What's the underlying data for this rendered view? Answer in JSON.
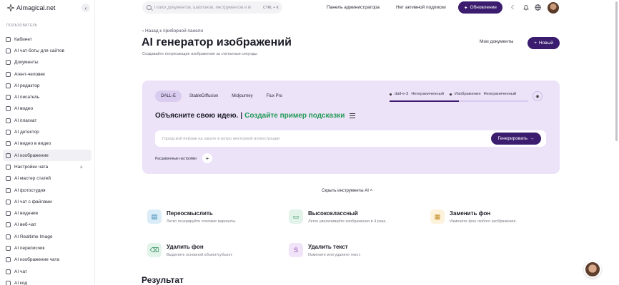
{
  "app": {
    "name": "AImagical.net"
  },
  "sidebar": {
    "section_label": "ПОЛЬЗОВАТЕЛЬ",
    "items": [
      {
        "label": "Кабинет",
        "icon": "dashboard-icon"
      },
      {
        "label": "AI чат-боты для сайтов",
        "icon": "bot-icon"
      },
      {
        "label": "Документы",
        "icon": "document-icon"
      },
      {
        "label": "Агент-человек",
        "icon": "agent-icon"
      },
      {
        "label": "AI редактор",
        "icon": "editor-icon"
      },
      {
        "label": "AI писатель",
        "icon": "writer-icon"
      },
      {
        "label": "AI видео",
        "icon": "video-icon"
      },
      {
        "label": "AI плагиат",
        "icon": "plagiarism-icon"
      },
      {
        "label": "AI детектор",
        "icon": "detector-icon"
      },
      {
        "label": "AI видео в видео",
        "icon": "video-to-video-icon"
      },
      {
        "label": "AI изображение",
        "icon": "image-icon",
        "active": true
      },
      {
        "label": "Настройки чата",
        "icon": "chat-settings-icon",
        "has_plus": true
      },
      {
        "label": "AI мастер статей",
        "icon": "article-icon"
      },
      {
        "label": "AI фотостудия",
        "icon": "photo-studio-icon"
      },
      {
        "label": "AI чат с файлами",
        "icon": "file-chat-icon"
      },
      {
        "label": "AI видение",
        "icon": "vision-icon"
      },
      {
        "label": "AI веб-чат",
        "icon": "web-chat-icon"
      },
      {
        "label": "AI Realtime Image",
        "icon": "realtime-image-icon"
      },
      {
        "label": "AI переписчик",
        "icon": "rewriter-icon"
      },
      {
        "label": "AI изображение чата",
        "icon": "chat-image-icon"
      },
      {
        "label": "AI чат",
        "icon": "chat-icon"
      },
      {
        "label": "AI код",
        "icon": "code-icon"
      }
    ]
  },
  "topbar": {
    "search_placeholder": "Поиск документов, шаблонов, инструментов и м",
    "search_shortcut": "CTRL + K",
    "admin_label": "Панель администратора",
    "subscription_label": "Нет активной подписки",
    "upgrade_label": "Обновление"
  },
  "header": {
    "breadcrumb": "Назад к приборной панели",
    "title": "AI генератор изображений",
    "subtitle": "Создавайте потрясающие изображения за считанные секунды.",
    "my_docs_label": "Мои документы",
    "new_label": "Новый"
  },
  "generator": {
    "tabs": [
      "DALL-E",
      "StableDiffusion",
      "Midjourney",
      "Flux Pro"
    ],
    "active_tab": "DALL-E",
    "model_name": "dall-e-3",
    "model_limit": "Неограниченный",
    "images_label": "Изображения",
    "images_limit": "Неограниченный",
    "usage_fraction": 0.5,
    "prompt_title": "Объясните свою идею.",
    "prompt_separator": "|",
    "prompt_example": "Создайте пример подсказки",
    "prompt_placeholder": "Городской пейзаж на закате в ретро векторной иллюстрации",
    "generate_label": "Генерировать",
    "advanced_label": "Расширенные настройки"
  },
  "tools": {
    "hide_label": "Скрыть инструменты AI",
    "items": [
      {
        "title": "Переосмыслить",
        "desc": "Легко генерируйте похожие варианты.",
        "icon": "reimagine-icon",
        "color": "#d9ecf7",
        "fg": "#2d7fb0"
      },
      {
        "title": "Высококлассный",
        "desc": "Легко увеличивайте изображения в 4 раза.",
        "icon": "upscale-icon",
        "color": "#e2f3ea",
        "fg": "#2e8a5a"
      },
      {
        "title": "Заменить фон",
        "desc": "Измените фон любого изображения.",
        "icon": "replace-background-icon",
        "color": "#fdf3dc",
        "fg": "#c08a1d"
      },
      {
        "title": "Удалить фон",
        "desc": "Выделите основной объект/субъект.",
        "icon": "remove-background-icon",
        "color": "#e2f3ea",
        "fg": "#2e8a5a"
      },
      {
        "title": "Удалить текст",
        "desc": "Измените или удалите текст.",
        "icon": "remove-text-icon",
        "color": "#f1e4f8",
        "fg": "#8a4fb0"
      }
    ]
  },
  "result": {
    "title": "Результат"
  }
}
